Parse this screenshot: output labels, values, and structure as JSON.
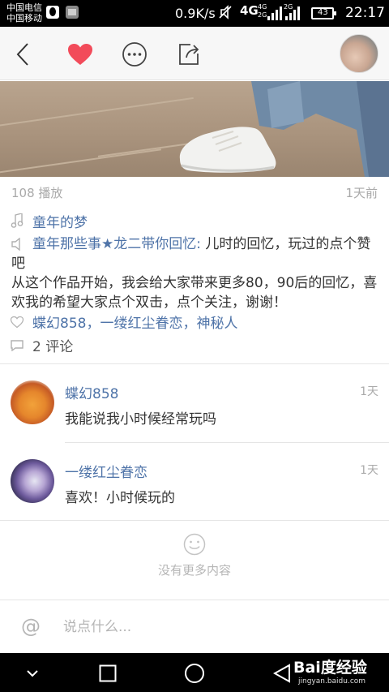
{
  "status_bar": {
    "carrier_1": "中国电信",
    "carrier_2": "中国移动",
    "speed": "0.9K/s",
    "network": "4G",
    "network_small_1": "4G",
    "network_small_2": "2G",
    "network_small_3": "2G",
    "battery": "43",
    "time": "22:17"
  },
  "toolbar": {
    "icons": [
      "back-icon",
      "heart-icon",
      "more-icon",
      "share-icon"
    ],
    "heart_color": "#f24b5a"
  },
  "video": {
    "plays": "108 播放",
    "posted": "1天前"
  },
  "music": {
    "title": "童年的梦"
  },
  "description": {
    "link": "童年那些事★龙二带你回忆:",
    "text": " 儿时的回忆，玩过的点个赞吧\n从这个作品开始，我会给大家带来更多80，90后的回忆，喜欢我的希望大家点个双击，点个关注，谢谢！"
  },
  "likes": {
    "users": "蝶幻858，一缕红尘眷恋，神秘人"
  },
  "comments_summary": {
    "count_label": "2 评论"
  },
  "comments": [
    {
      "name": "蝶幻858",
      "time": "1天",
      "text": "我能说我小时候经常玩吗"
    },
    {
      "name": "一缕红尘眷恋",
      "time": "1天",
      "text": "喜欢！小时候玩的"
    }
  ],
  "footer": {
    "no_more": "没有更多内容"
  },
  "input": {
    "placeholder": "说点什么..."
  },
  "watermark": {
    "main": "Bai度经验",
    "sub": "jingyan.baidu.com"
  },
  "colors": {
    "link": "#4e73a8",
    "accent": "#f24b5a"
  }
}
